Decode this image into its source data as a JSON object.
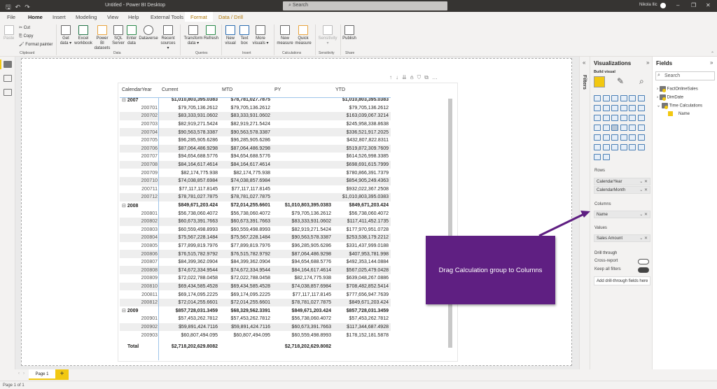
{
  "titlebar": {
    "title": "Untitled - Power BI Desktop",
    "search_placeholder": "Search",
    "user": "Nikola Ilic",
    "icons": [
      "save-icon",
      "undo-icon",
      "redo-icon",
      "minimize-icon",
      "restore-icon",
      "close-icon"
    ]
  },
  "menu": {
    "items": [
      "File",
      "Home",
      "Insert",
      "Modeling",
      "View",
      "Help",
      "External Tools"
    ],
    "active": "Home",
    "context_tabs": [
      "Format",
      "Data / Drill"
    ]
  },
  "ribbon": {
    "clipboard": {
      "paste": "Paste",
      "cut": "Cut",
      "copy": "Copy",
      "format_painter": "Format painter",
      "group": "Clipboard"
    },
    "data": {
      "buttons": [
        "Get data ▾",
        "Excel workbook",
        "Power BI datasets",
        "SQL Server",
        "Enter data",
        "Dataverse",
        "Recent sources ▾"
      ],
      "group": "Data"
    },
    "queries": {
      "buttons": [
        "Transform data ▾",
        "Refresh"
      ],
      "group": "Queries"
    },
    "insert": {
      "buttons": [
        "New visual",
        "Text box",
        "More visuals ▾"
      ],
      "group": "Insert"
    },
    "calculations": {
      "buttons": [
        "New measure",
        "Quick measure"
      ],
      "group": "Calculations"
    },
    "sensitivity": {
      "buttons": [
        "Sensitivity ▾"
      ],
      "group": "Sensitivity"
    },
    "share": {
      "buttons": [
        "Publish"
      ],
      "group": "Share"
    }
  },
  "matrix": {
    "headers": [
      "CalendarYear",
      "Current",
      "MTD",
      "PY",
      "YTD"
    ],
    "rows": [
      {
        "type": "year",
        "label": "2007",
        "current": "$1,010,803,395.0383",
        "mtd": "$78,781,027.7875",
        "py": "",
        "ytd": "$1,010,803,395.0383"
      },
      {
        "type": "month",
        "label": "200701",
        "current": "$79,705,136.2612",
        "mtd": "$79,705,136.2612",
        "py": "",
        "ytd": "$79,705,136.2612"
      },
      {
        "type": "month",
        "label": "200702",
        "current": "$83,333,931.0602",
        "mtd": "$83,333,931.0602",
        "py": "",
        "ytd": "$163,039,067.3214"
      },
      {
        "type": "month",
        "label": "200703",
        "current": "$82,919,271.5424",
        "mtd": "$82,919,271.5424",
        "py": "",
        "ytd": "$245,958,338.8638"
      },
      {
        "type": "month",
        "label": "200704",
        "current": "$90,563,578.3387",
        "mtd": "$90,563,578.3387",
        "py": "",
        "ytd": "$336,521,917.2025"
      },
      {
        "type": "month",
        "label": "200705",
        "current": "$96,285,905.6286",
        "mtd": "$96,285,905.6286",
        "py": "",
        "ytd": "$432,807,822.8311"
      },
      {
        "type": "month",
        "label": "200706",
        "current": "$87,064,486.9298",
        "mtd": "$87,064,486.9298",
        "py": "",
        "ytd": "$519,872,309.7609"
      },
      {
        "type": "month",
        "label": "200707",
        "current": "$94,654,688.5776",
        "mtd": "$94,654,688.5776",
        "py": "",
        "ytd": "$614,526,998.3385"
      },
      {
        "type": "month",
        "label": "200708",
        "current": "$84,164,617.4614",
        "mtd": "$84,164,617.4614",
        "py": "",
        "ytd": "$698,691,615.7999"
      },
      {
        "type": "month",
        "label": "200709",
        "current": "$82,174,775.938",
        "mtd": "$82,174,775.938",
        "py": "",
        "ytd": "$780,866,391.7379"
      },
      {
        "type": "month",
        "label": "200710",
        "current": "$74,038,857.6984",
        "mtd": "$74,038,857.6984",
        "py": "",
        "ytd": "$854,905,249.4363"
      },
      {
        "type": "month",
        "label": "200711",
        "current": "$77,117,117.8145",
        "mtd": "$77,117,117.8145",
        "py": "",
        "ytd": "$932,022,367.2508"
      },
      {
        "type": "month",
        "label": "200712",
        "current": "$78,781,027.7875",
        "mtd": "$78,781,027.7875",
        "py": "",
        "ytd": "$1,010,803,395.0383"
      },
      {
        "type": "year",
        "label": "2008",
        "current": "$849,671,203.424",
        "mtd": "$72,014,255.6601",
        "py": "$1,010,803,395.0383",
        "ytd": "$849,671,203.424"
      },
      {
        "type": "month",
        "label": "200801",
        "current": "$56,738,060.4072",
        "mtd": "$56,738,060.4072",
        "py": "$79,705,136.2612",
        "ytd": "$56,738,060.4072"
      },
      {
        "type": "month",
        "label": "200802",
        "current": "$60,673,391.7663",
        "mtd": "$60,673,391.7663",
        "py": "$83,333,931.0602",
        "ytd": "$117,411,452.1735"
      },
      {
        "type": "month",
        "label": "200803",
        "current": "$60,559,498.8993",
        "mtd": "$60,559,498.8993",
        "py": "$82,919,271.5424",
        "ytd": "$177,970,951.0728"
      },
      {
        "type": "month",
        "label": "200804",
        "current": "$75,567,228.1484",
        "mtd": "$75,567,228.1484",
        "py": "$90,563,578.3387",
        "ytd": "$253,538,179.2212"
      },
      {
        "type": "month",
        "label": "200805",
        "current": "$77,899,819.7976",
        "mtd": "$77,899,819.7976",
        "py": "$96,285,905.6286",
        "ytd": "$331,437,999.0188"
      },
      {
        "type": "month",
        "label": "200806",
        "current": "$76,515,782.9792",
        "mtd": "$76,515,782.9792",
        "py": "$87,064,486.9298",
        "ytd": "$407,953,781.998"
      },
      {
        "type": "month",
        "label": "200807",
        "current": "$84,399,362.0904",
        "mtd": "$84,399,362.0904",
        "py": "$94,654,688.5776",
        "ytd": "$492,353,144.0884"
      },
      {
        "type": "month",
        "label": "200808",
        "current": "$74,672,334.9544",
        "mtd": "$74,672,334.9544",
        "py": "$84,164,617.4614",
        "ytd": "$567,025,479.0428"
      },
      {
        "type": "month",
        "label": "200809",
        "current": "$72,022,788.0458",
        "mtd": "$72,022,788.0458",
        "py": "$82,174,775.938",
        "ytd": "$639,048,267.0886"
      },
      {
        "type": "month",
        "label": "200810",
        "current": "$69,434,585.4528",
        "mtd": "$69,434,585.4528",
        "py": "$74,038,857.6984",
        "ytd": "$708,482,852.5414"
      },
      {
        "type": "month",
        "label": "200811",
        "current": "$69,174,095.2225",
        "mtd": "$69,174,095.2225",
        "py": "$77,117,117.8145",
        "ytd": "$777,656,947.7639"
      },
      {
        "type": "month",
        "label": "200812",
        "current": "$72,014,255.6601",
        "mtd": "$72,014,255.6601",
        "py": "$78,781,027.7875",
        "ytd": "$849,671,203.424"
      },
      {
        "type": "year",
        "label": "2009",
        "current": "$857,728,031.3459",
        "mtd": "$68,329,562.3391",
        "py": "$849,671,203.424",
        "ytd": "$857,728,031.3459"
      },
      {
        "type": "month",
        "label": "200901",
        "current": "$57,453,262.7812",
        "mtd": "$57,453,262.7812",
        "py": "$56,738,060.4072",
        "ytd": "$57,453,262.7812"
      },
      {
        "type": "month",
        "label": "200902",
        "current": "$59,891,424.7116",
        "mtd": "$59,891,424.7116",
        "py": "$60,673,391.7663",
        "ytd": "$117,344,687.4928"
      },
      {
        "type": "month",
        "label": "200903",
        "current": "$60,807,494.095",
        "mtd": "$60,807,494.095",
        "py": "$60,559,498.8993",
        "ytd": "$178,152,181.5878"
      }
    ],
    "total": {
      "label": "Total",
      "current": "$2,718,202,629.8082",
      "mtd": "",
      "py": "$2,718,202,629.8082",
      "ytd": ""
    }
  },
  "visual_tools": [
    "drill-up-icon",
    "drill-down-icon",
    "next-level-icon",
    "expand-hierarchy-icon",
    "filter-icon",
    "focus-mode-icon",
    "more-options-icon"
  ],
  "filters": {
    "label": "Filters"
  },
  "visualizations": {
    "title": "Visualizations",
    "build_visual": "Build visual",
    "rows_label": "Rows",
    "rows": [
      "CalendarYear",
      "CalendarMonth"
    ],
    "columns_label": "Columns",
    "columns": [
      "Name"
    ],
    "values_label": "Values",
    "values": [
      "Sales Amount"
    ],
    "drill_through": "Drill through",
    "cross_report": "Cross-report",
    "cross_report_state": "Off",
    "keep_filters": "Keep all filters",
    "keep_filters_state": "On",
    "add_drill": "Add drill-through fields here"
  },
  "fields": {
    "title": "Fields",
    "search_placeholder": "Search",
    "tables": [
      {
        "name": "FactOnlineSales",
        "expanded": false
      },
      {
        "name": "DimDate",
        "expanded": false
      },
      {
        "name": "Time Calculations",
        "expanded": true,
        "children": [
          "Name"
        ]
      }
    ]
  },
  "callout": {
    "text": "Drag Calculation group to Columns",
    "color": "#5f1f82"
  },
  "pages": {
    "tabs": [
      "Page 1"
    ],
    "add": "+"
  },
  "status": {
    "text": "Page 1 of 1"
  },
  "colors": {
    "accent": "#f2c811",
    "callout": "#5f1f82",
    "header_line": "#9ec4ea"
  }
}
